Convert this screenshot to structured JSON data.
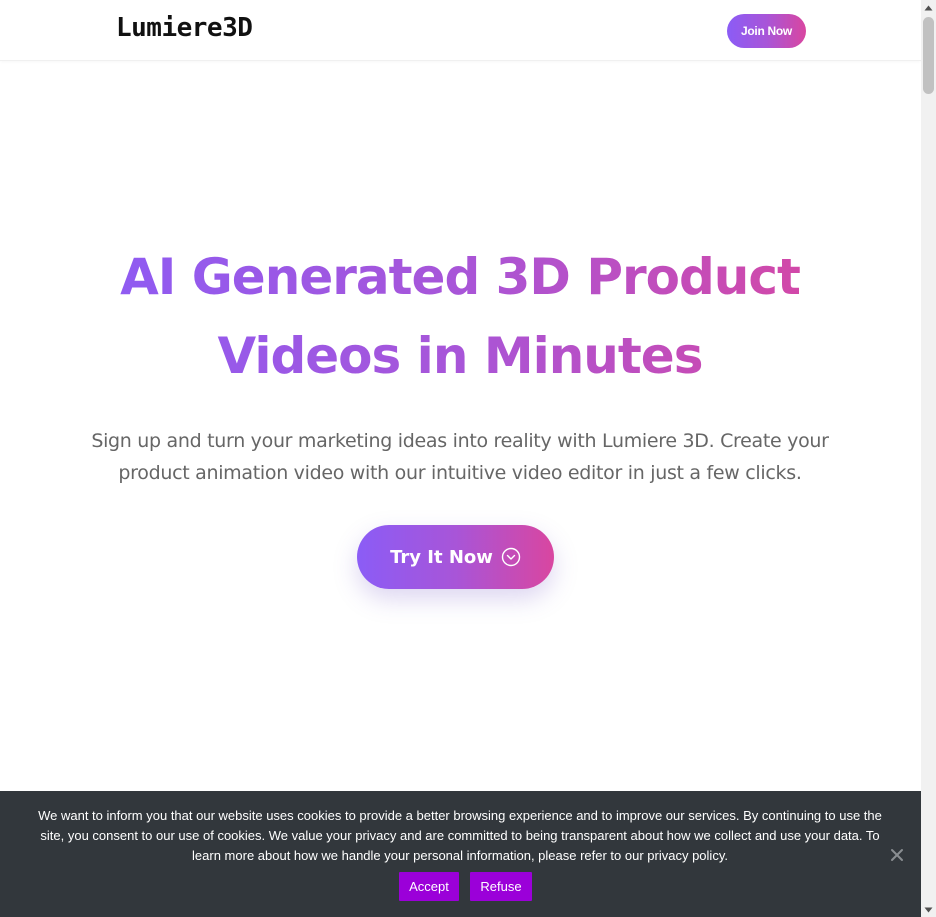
{
  "colors": {
    "gradient_start": "#8b5cf6",
    "gradient_mid": "#a855d8",
    "gradient_end": "#d946a0",
    "cookie_bg": "#32373c",
    "cookie_button": "#9b00d9",
    "subtitle_text": "#666666"
  },
  "header": {
    "logo": "Lumiere3D",
    "join_button": "Join Now"
  },
  "hero": {
    "title_line1": "AI Generated 3D Product",
    "title_line2": "Videos in Minutes",
    "subtitle_line1": "Sign up and turn your marketing ideas into reality with Lumiere 3D. Create your",
    "subtitle_line2": "product animation video with our intuitive video editor in just a few clicks.",
    "cta_label": "Try It Now",
    "cta_icon": "chevron-circle-down-icon"
  },
  "cookie_banner": {
    "line1": "We want to inform you that our website uses cookies to provide a better browsing experience and to improve our services. By continuing to use the",
    "line2": "site, you consent to our use of cookies. We value your privacy and are committed to being transparent about how we collect and use your data. To",
    "line3": "learn more about how we handle your personal information, please refer to our privacy policy.",
    "accept_label": "Accept",
    "refuse_label": "Refuse",
    "close_icon": "close-icon"
  }
}
